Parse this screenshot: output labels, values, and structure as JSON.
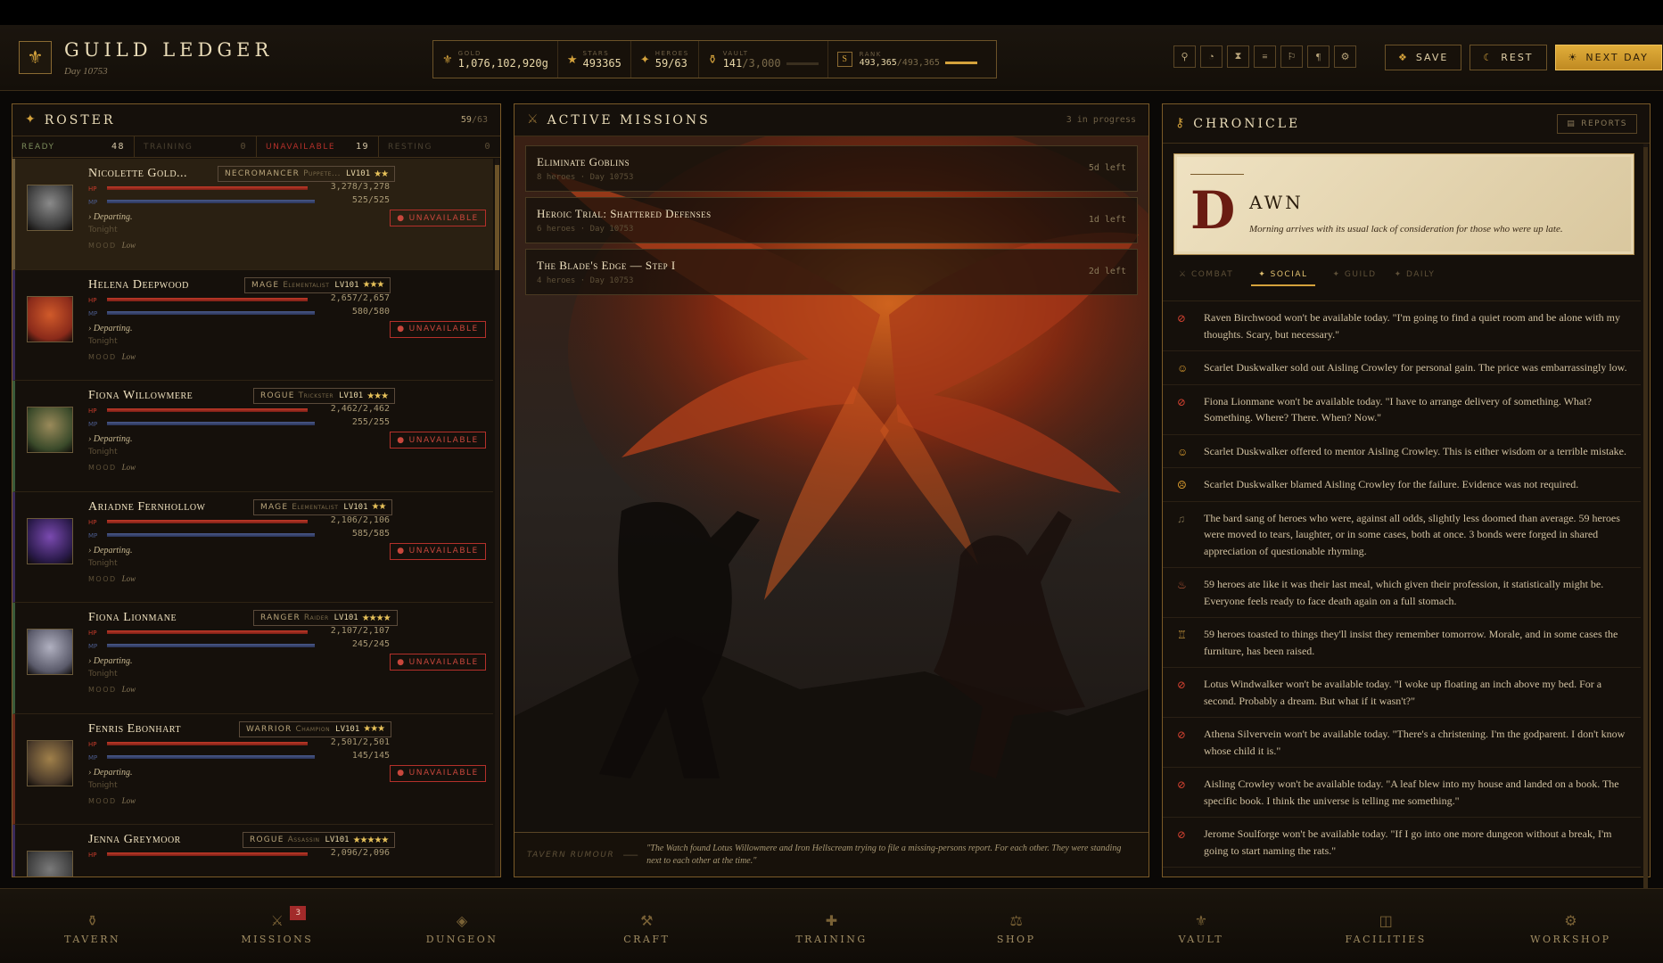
{
  "header": {
    "title": "GUILD LEDGER",
    "day": "Day 10753",
    "stats": {
      "gold_label": "GOLD",
      "gold": "1,076,102,920g",
      "stars_label": "STARS",
      "stars": "493365",
      "heroes_label": "HEROES",
      "heroes": "59/63",
      "vault_label": "VAULT",
      "vault": "141",
      "vault_max": "/3,000",
      "rank_label": "RANK",
      "rank": "493,365",
      "rank_max": "/493,365"
    },
    "actions": {
      "save": "SAVE",
      "rest": "REST",
      "next_day": "NEXT DAY"
    }
  },
  "roster": {
    "title": "ROSTER",
    "count": "59",
    "count_max": "/63",
    "tabs": [
      {
        "label": "READY",
        "count": "48"
      },
      {
        "label": "TRAINING",
        "count": "0"
      },
      {
        "label": "UNAVAILABLE",
        "count": "19"
      },
      {
        "label": "RESTING",
        "count": "0"
      }
    ],
    "heroes": [
      {
        "name": "Nicolette Gold...",
        "cls": "NECROMANCER",
        "sub": "Puppete...",
        "lv": "LV101",
        "stars": "★★",
        "hp": "3,278/3,278",
        "mp": "525/525",
        "status": "UNAVAILABLE",
        "dep": "› Departing.",
        "when": "Tonight",
        "mood_label": "MOOD",
        "mood": "Low"
      },
      {
        "name": "Helena Deepwood",
        "cls": "MAGE",
        "sub": "Elementalist",
        "lv": "LV101",
        "stars": "★★★",
        "hp": "2,657/2,657",
        "mp": "580/580",
        "status": "UNAVAILABLE",
        "dep": "› Departing.",
        "when": "Tonight",
        "mood_label": "MOOD",
        "mood": "Low"
      },
      {
        "name": "Fiona Willowmere",
        "cls": "ROGUE",
        "sub": "Trickster",
        "lv": "LV101",
        "stars": "★★★",
        "hp": "2,462/2,462",
        "mp": "255/255",
        "status": "UNAVAILABLE",
        "dep": "› Departing.",
        "when": "Tonight",
        "mood_label": "MOOD",
        "mood": "Low"
      },
      {
        "name": "Ariadne Fernhollow",
        "cls": "MAGE",
        "sub": "Elementalist",
        "lv": "LV101",
        "stars": "★★",
        "hp": "2,106/2,106",
        "mp": "585/585",
        "status": "UNAVAILABLE",
        "dep": "› Departing.",
        "when": "Tonight",
        "mood_label": "MOOD",
        "mood": "Low"
      },
      {
        "name": "Fiona Lionmane",
        "cls": "RANGER",
        "sub": "Raider",
        "lv": "LV101",
        "stars": "★★★★",
        "hp": "2,107/2,107",
        "mp": "245/245",
        "status": "UNAVAILABLE",
        "dep": "› Departing.",
        "when": "Tonight",
        "mood_label": "MOOD",
        "mood": "Low"
      },
      {
        "name": "Fenris Ebonhart",
        "cls": "WARRIOR",
        "sub": "Champion",
        "lv": "LV101",
        "stars": "★★★",
        "hp": "2,501/2,501",
        "mp": "145/145",
        "status": "UNAVAILABLE",
        "dep": "› Departing.",
        "when": "Tonight",
        "mood_label": "MOOD",
        "mood": "Low"
      },
      {
        "name": "Jenna Greymoor",
        "cls": "ROGUE",
        "sub": "Assassin",
        "lv": "LV101",
        "stars": "★★★★★",
        "hp": "2,096/2,096",
        "mp": "",
        "status": "",
        "dep": "",
        "when": "",
        "mood_label": "",
        "mood": ""
      }
    ]
  },
  "missions": {
    "title": "ACTIVE MISSIONS",
    "status": "3 in progress",
    "list": [
      {
        "name": "Eliminate Goblins",
        "sub": "8 heroes · Day 10753",
        "left": "5d left"
      },
      {
        "name": "Heroic Trial: Shattered Defenses",
        "sub": "6 heroes · Day 10753",
        "left": "1d left"
      },
      {
        "name": "The Blade's Edge — Step I",
        "sub": "4 heroes · Day 10753",
        "left": "2d left"
      }
    ],
    "rumour_label": "TAVERN RUMOUR",
    "rumour": "\"The Watch found Lotus Willowmere and Iron Hellscream trying to file a missing-persons report. For each other. They were standing next to each other at the time.\""
  },
  "chronicle": {
    "title": "CHRONICLE",
    "reports": "REPORTS",
    "dropcap": "D",
    "heading": "AWN",
    "intro": "Morning arrives with its usual lack of consideration for those who were up late.",
    "tabs": [
      "COMBAT",
      "SOCIAL",
      "GUILD",
      "DAILY"
    ],
    "entries": [
      {
        "icon": "⃠",
        "color": "#d04030",
        "text": "Raven Birchwood won't be available today. \"I'm going to find a quiet room and be alone with my thoughts. Scary, but necessary.\""
      },
      {
        "icon": "☺",
        "color": "#e0a030",
        "text": "Scarlet Duskwalker sold out Aisling Crowley for personal gain. The price was embarrassingly low."
      },
      {
        "icon": "⃠",
        "color": "#d04030",
        "text": "Fiona Lionmane won't be available today. \"I have to arrange delivery of something. What? Something. Where? There. When? Now.\""
      },
      {
        "icon": "☺",
        "color": "#e0a030",
        "text": "Scarlet Duskwalker offered to mentor Aisling Crowley. This is either wisdom or a terrible mistake."
      },
      {
        "icon": "☹",
        "color": "#e0a030",
        "text": "Scarlet Duskwalker blamed Aisling Crowley for the failure. Evidence was not required."
      },
      {
        "icon": "♫",
        "color": "#7a6a4a",
        "text": "The bard sang of heroes who were, against all odds, slightly less doomed than average. 59 heroes were moved to tears, laughter, or in some cases, both at once. 3 bonds were forged in shared appreciation of questionable rhyming."
      },
      {
        "icon": "♨",
        "color": "#c05a3a",
        "text": "59 heroes ate like it was their last meal, which given their profession, it statistically might be. Everyone feels ready to face death again on a full stomach."
      },
      {
        "icon": "♖",
        "color": "#c0903a",
        "text": "59 heroes toasted to things they'll insist they remember tomorrow. Morale, and in some cases the furniture, has been raised."
      },
      {
        "icon": "⃠",
        "color": "#d04030",
        "text": "Lotus Windwalker won't be available today. \"I woke up floating an inch above my bed. For a second. Probably a dream. But what if it wasn't?\""
      },
      {
        "icon": "⃠",
        "color": "#d04030",
        "text": "Athena Silvervein won't be available today. \"There's a christening. I'm the godparent. I don't know whose child it is.\""
      },
      {
        "icon": "⃠",
        "color": "#d04030",
        "text": "Aisling Crowley won't be available today. \"A leaf blew into my house and landed on a book. The specific book. I think the universe is telling me something.\""
      },
      {
        "icon": "⃠",
        "color": "#d04030",
        "text": "Jerome Soulforge won't be available today. \"If I go into one more dungeon without a break, I'm going to start naming the rats.\""
      }
    ]
  },
  "nav": [
    {
      "label": "TAVERN",
      "icon": "⚱",
      "badge": ""
    },
    {
      "label": "MISSIONS",
      "icon": "⚔",
      "badge": "3"
    },
    {
      "label": "DUNGEON",
      "icon": "◈",
      "badge": ""
    },
    {
      "label": "CRAFT",
      "icon": "⚒",
      "badge": ""
    },
    {
      "label": "TRAINING",
      "icon": "✚",
      "badge": ""
    },
    {
      "label": "SHOP",
      "icon": "⚖",
      "badge": ""
    },
    {
      "label": "VAULT",
      "icon": "⚜",
      "badge": ""
    },
    {
      "label": "FACILITIES",
      "icon": "◫",
      "badge": ""
    },
    {
      "label": "WORKSHOP",
      "icon": "⚙",
      "badge": ""
    }
  ],
  "colors": {
    "accent": "#d4a23c",
    "danger": "#c8473c",
    "panel_border": "#7a5a28",
    "bg": "#15100b"
  }
}
